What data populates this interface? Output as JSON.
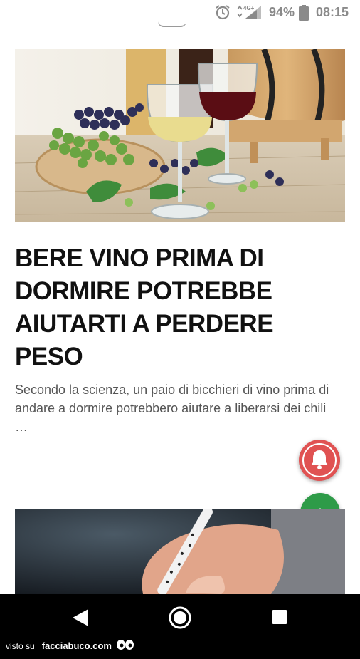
{
  "status_bar": {
    "network": "4G+",
    "battery_percent": "94%",
    "time": "08:15",
    "icons": [
      "alarm-icon",
      "signal-icon",
      "battery-icon"
    ]
  },
  "article": {
    "title": "BERE VINO PRIMA DI DORMIRE POTREBBE AIUTARTI A PERDERE PESO",
    "excerpt": "Secondo la scienza, un paio di bicchieri di vino prima di andare a dormire potrebbero aiutare a liberarsi dei chili …",
    "image_subject": "wine glasses, grapes and barrel on wooden table"
  },
  "floating_buttons": {
    "notify_icon": "bell-icon",
    "notify_color": "#e05252",
    "scroll_top_icon": "chevron-up-icon",
    "scroll_top_color": "#2e9b48"
  },
  "navigation_bar": {
    "icons": [
      "back-icon",
      "home-icon",
      "recents-icon"
    ]
  },
  "watermark": {
    "prefix": "visto su",
    "site": "facciabuco.com"
  }
}
